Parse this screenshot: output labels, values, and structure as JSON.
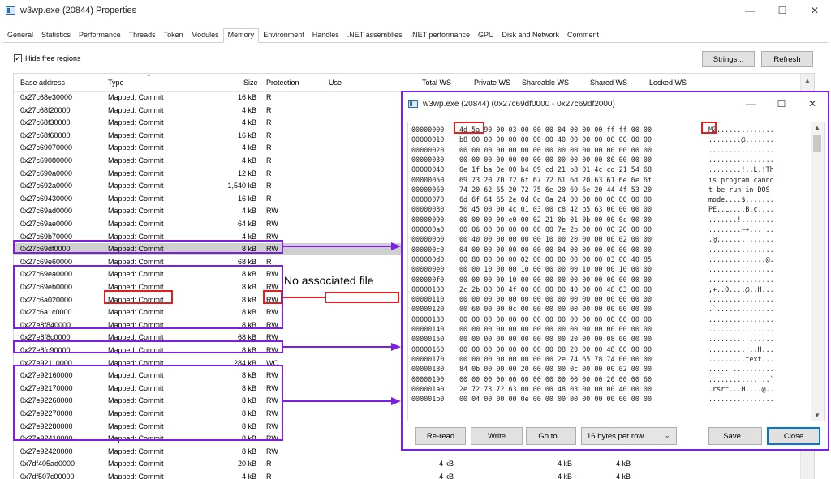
{
  "window": {
    "title": "w3wp.exe (20844) Properties",
    "minimize": "—",
    "maximize": "☐",
    "close": "✕"
  },
  "tabs": [
    "General",
    "Statistics",
    "Performance",
    "Threads",
    "Token",
    "Modules",
    "Memory",
    "Environment",
    "Handles",
    ".NET assemblies",
    ".NET performance",
    "GPU",
    "Disk and Network",
    "Comment"
  ],
  "active_tab": "Memory",
  "toolbar": {
    "hide_free_label": "Hide free regions",
    "hide_free_checked": true,
    "strings_label": "Strings...",
    "refresh_label": "Refresh"
  },
  "columns": {
    "base": "Base address",
    "type": "Type",
    "size": "Size",
    "protection": "Protection",
    "use": "Use",
    "total_ws": "Total WS",
    "private_ws": "Private WS",
    "shareable_ws": "Shareable WS",
    "shared_ws": "Shared WS",
    "locked_ws": "Locked WS"
  },
  "rows": [
    {
      "addr": "0x27c68e30000",
      "type": "Mapped: Commit",
      "size": "16 kB",
      "prot": "R"
    },
    {
      "addr": "0x27c68f20000",
      "type": "Mapped: Commit",
      "size": "4 kB",
      "prot": "R"
    },
    {
      "addr": "0x27c68f30000",
      "type": "Mapped: Commit",
      "size": "4 kB",
      "prot": "R"
    },
    {
      "addr": "0x27c68f60000",
      "type": "Mapped: Commit",
      "size": "16 kB",
      "prot": "R"
    },
    {
      "addr": "0x27c69070000",
      "type": "Mapped: Commit",
      "size": "4 kB",
      "prot": "R"
    },
    {
      "addr": "0x27c69080000",
      "type": "Mapped: Commit",
      "size": "4 kB",
      "prot": "R"
    },
    {
      "addr": "0x27c690a0000",
      "type": "Mapped: Commit",
      "size": "12 kB",
      "prot": "R"
    },
    {
      "addr": "0x27c692a0000",
      "type": "Mapped: Commit",
      "size": "1,540 kB",
      "prot": "R"
    },
    {
      "addr": "0x27c69430000",
      "type": "Mapped: Commit",
      "size": "16 kB",
      "prot": "R"
    },
    {
      "addr": "0x27c69ad0000",
      "type": "Mapped: Commit",
      "size": "4 kB",
      "prot": "RW"
    },
    {
      "addr": "0x27c69ae0000",
      "type": "Mapped: Commit",
      "size": "64 kB",
      "prot": "RW"
    },
    {
      "addr": "0x27c69b70000",
      "type": "Mapped: Commit",
      "size": "4 kB",
      "prot": "RW"
    },
    {
      "addr": "0x27c69df0000",
      "type": "Mapped: Commit",
      "size": "8 kB",
      "prot": "RW",
      "selected": true
    },
    {
      "addr": "0x27c69e60000",
      "type": "Mapped: Commit",
      "size": "68 kB",
      "prot": "R"
    },
    {
      "addr": "0x27c69ea0000",
      "type": "Mapped: Commit",
      "size": "8 kB",
      "prot": "RW"
    },
    {
      "addr": "0x27c69eb0000",
      "type": "Mapped: Commit",
      "size": "8 kB",
      "prot": "RW"
    },
    {
      "addr": "0x27c6a020000",
      "type": "Mapped: Commit",
      "size": "8 kB",
      "prot": "RW"
    },
    {
      "addr": "0x27c6a1c0000",
      "type": "Mapped: Commit",
      "size": "8 kB",
      "prot": "RW"
    },
    {
      "addr": "0x27e8f840000",
      "type": "Mapped: Commit",
      "size": "8 kB",
      "prot": "RW"
    },
    {
      "addr": "0x27e8f8c0000",
      "type": "Mapped: Commit",
      "size": "68 kB",
      "prot": "RW"
    },
    {
      "addr": "0x27e8fc90000",
      "type": "Mapped: Commit",
      "size": "8 kB",
      "prot": "RW"
    },
    {
      "addr": "0x27e92110000",
      "type": "Mapped: Commit",
      "size": "284 kB",
      "prot": "WC"
    },
    {
      "addr": "0x27e92160000",
      "type": "Mapped: Commit",
      "size": "8 kB",
      "prot": "RW"
    },
    {
      "addr": "0x27e92170000",
      "type": "Mapped: Commit",
      "size": "8 kB",
      "prot": "RW"
    },
    {
      "addr": "0x27e92260000",
      "type": "Mapped: Commit",
      "size": "8 kB",
      "prot": "RW"
    },
    {
      "addr": "0x27e92270000",
      "type": "Mapped: Commit",
      "size": "8 kB",
      "prot": "RW"
    },
    {
      "addr": "0x27e92280000",
      "type": "Mapped: Commit",
      "size": "8 kB",
      "prot": "RW"
    },
    {
      "addr": "0x27e92410000",
      "type": "Mapped: Commit",
      "size": "8 kB",
      "prot": "RW"
    },
    {
      "addr": "0x27e92420000",
      "type": "Mapped: Commit",
      "size": "8 kB",
      "prot": "RW"
    },
    {
      "addr": "0x7df405ad0000",
      "type": "Mapped: Commit",
      "size": "20 kB",
      "prot": "R",
      "tws": "4 kB",
      "sws": "4 kB",
      "lws": "4 kB"
    },
    {
      "addr": "0x7df507c00000",
      "type": "Mapped: Commit",
      "size": "4 kB",
      "prot": "R",
      "tws": "4 kB",
      "sws": "4 kB",
      "lws": "4 kB"
    }
  ],
  "annotation": {
    "no_file": "No associated file"
  },
  "hex_window": {
    "title": "w3wp.exe (20844) (0x27c69df0000 - 0x27c69df2000)",
    "minimize": "—",
    "maximize": "☐",
    "close": "✕",
    "lines": [
      {
        "off": "00000000",
        "bytes": "4d 5a 90 00 03 00 00 00 04 00 00 00 ff ff 00 00",
        "ascii": "MZ.............."
      },
      {
        "off": "00000010",
        "bytes": "b8 00 00 00 00 00 00 00 40 00 00 00 00 00 00 00",
        "ascii": "........@......."
      },
      {
        "off": "00000020",
        "bytes": "00 00 00 00 00 00 00 00 00 00 00 00 00 00 00 00",
        "ascii": "................"
      },
      {
        "off": "00000030",
        "bytes": "00 00 00 00 00 00 00 00 00 00 00 00 80 00 00 00",
        "ascii": "................"
      },
      {
        "off": "00000040",
        "bytes": "0e 1f ba 0e 00 b4 09 cd 21 b8 01 4c cd 21 54 68",
        "ascii": "........!..L.!Th"
      },
      {
        "off": "00000050",
        "bytes": "69 73 20 70 72 6f 67 72 61 6d 20 63 61 6e 6e 6f",
        "ascii": "is program canno"
      },
      {
        "off": "00000060",
        "bytes": "74 20 62 65 20 72 75 6e 20 69 6e 20 44 4f 53 20",
        "ascii": "t be run in DOS "
      },
      {
        "off": "00000070",
        "bytes": "6d 6f 64 65 2e 0d 0d 0a 24 00 00 00 00 00 00 00",
        "ascii": "mode....$......."
      },
      {
        "off": "00000080",
        "bytes": "50 45 00 00 4c 01 03 00 c8 42 b5 63 00 00 00 00",
        "ascii": "PE..L....B.c...."
      },
      {
        "off": "00000090",
        "bytes": "00 00 00 00 e0 00 02 21 0b 01 0b 00 00 0c 00 00",
        "ascii": ".......!........"
      },
      {
        "off": "000000a0",
        "bytes": "00 06 00 00 00 00 00 00 7e 2b 00 00 00 20 00 00",
        "ascii": "........~+... .."
      },
      {
        "off": "000000b0",
        "bytes": "00 40 00 00 00 00 00 10 00 20 00 00 00 02 00 00",
        "ascii": ".@....... ......"
      },
      {
        "off": "000000c0",
        "bytes": "04 00 00 00 00 00 00 00 04 00 00 00 00 00 00 00",
        "ascii": "................"
      },
      {
        "off": "000000d0",
        "bytes": "00 80 00 00 00 02 00 00 00 00 00 00 03 00 40 85",
        "ascii": "..............@."
      },
      {
        "off": "000000e0",
        "bytes": "00 00 10 00 00 10 00 00 00 00 10 00 00 10 00 00",
        "ascii": "................"
      },
      {
        "off": "000000f0",
        "bytes": "00 00 00 00 10 00 00 00 00 00 00 00 00 00 00 00",
        "ascii": "................"
      },
      {
        "off": "00000100",
        "bytes": "2c 2b 00 00 4f 00 00 00 00 40 00 00 48 03 00 00",
        "ascii": ",+..O....@..H..."
      },
      {
        "off": "00000110",
        "bytes": "00 00 00 00 00 00 00 00 00 00 00 00 00 00 00 00",
        "ascii": "................"
      },
      {
        "off": "00000120",
        "bytes": "00 60 00 00 0c 00 00 00 00 00 00 00 00 00 00 00",
        "ascii": ".`.............."
      },
      {
        "off": "00000130",
        "bytes": "00 00 00 00 00 00 00 00 00 00 00 00 00 00 00 00",
        "ascii": "................"
      },
      {
        "off": "00000140",
        "bytes": "00 00 00 00 00 00 00 00 00 00 00 00 00 00 00 00",
        "ascii": "................"
      },
      {
        "off": "00000150",
        "bytes": "00 00 00 00 00 00 00 00 00 20 00 00 08 00 00 00",
        "ascii": "......... ......"
      },
      {
        "off": "00000160",
        "bytes": "00 00 00 00 00 00 00 00 08 20 00 00 48 00 00 00",
        "ascii": "......... ..H..."
      },
      {
        "off": "00000170",
        "bytes": "00 00 00 00 00 00 00 00 2e 74 65 78 74 00 00 00",
        "ascii": ".........text..."
      },
      {
        "off": "00000180",
        "bytes": "84 0b 00 00 00 20 00 00 00 0c 00 00 00 02 00 00",
        "ascii": "..... .........."
      },
      {
        "off": "00000190",
        "bytes": "00 00 00 00 00 00 00 00 00 00 00 00 20 00 00 60",
        "ascii": "............ ..`"
      },
      {
        "off": "000001a0",
        "bytes": "2e 72 73 72 63 00 00 00 48 03 00 00 00 40 00 00",
        "ascii": ".rsrc...H....@.."
      },
      {
        "off": "000001b0",
        "bytes": "00 04 00 00 00 0e 00 00 00 00 00 00 00 00 00 00",
        "ascii": "................"
      }
    ],
    "reread_label": "Re-read",
    "write_label": "Write",
    "goto_label": "Go to...",
    "bytes_per_row": "16 bytes per row",
    "save_label": "Save...",
    "close_label": "Close"
  },
  "colors": {
    "annotation_purple": "#7c1fe0",
    "annotation_red": "#e02020",
    "selected_row": "#cfcfcf"
  }
}
